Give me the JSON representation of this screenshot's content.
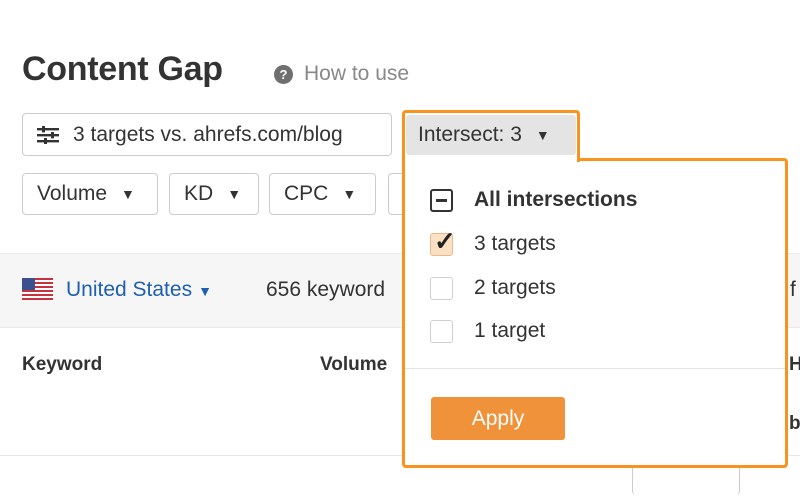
{
  "header": {
    "title": "Content Gap",
    "help_icon_glyph": "?",
    "help_label": "How to use"
  },
  "toolbar": {
    "targets_label": "3 targets vs. ahrefs.com/blog",
    "intersect_label": "Intersect: 3",
    "filters": [
      {
        "label": "Volume"
      },
      {
        "label": "KD"
      },
      {
        "label": "CPC"
      }
    ]
  },
  "country_bar": {
    "country": "United States",
    "keyword_count": "656 keyword",
    "truncated_right": "f"
  },
  "table": {
    "columns": [
      "Keyword",
      "Volume"
    ],
    "truncated_head_right": "H",
    "truncated_sub_right": "b"
  },
  "intersect_dropdown": {
    "options": [
      {
        "label": "All intersections",
        "state": "indeterminate"
      },
      {
        "label": "3 targets",
        "state": "checked"
      },
      {
        "label": "2 targets",
        "state": "unchecked"
      },
      {
        "label": "1 target",
        "state": "unchecked"
      }
    ],
    "apply_label": "Apply",
    "check_glyph": "✓"
  },
  "colors": {
    "accent_orange": "#f7931e",
    "apply_button": "#f0923a",
    "link_blue": "#1f5fad"
  },
  "icons": {
    "help": "question-circle-icon",
    "targets": "sliders-icon",
    "caret": "caret-down-icon",
    "flag": "us-flag-icon"
  }
}
